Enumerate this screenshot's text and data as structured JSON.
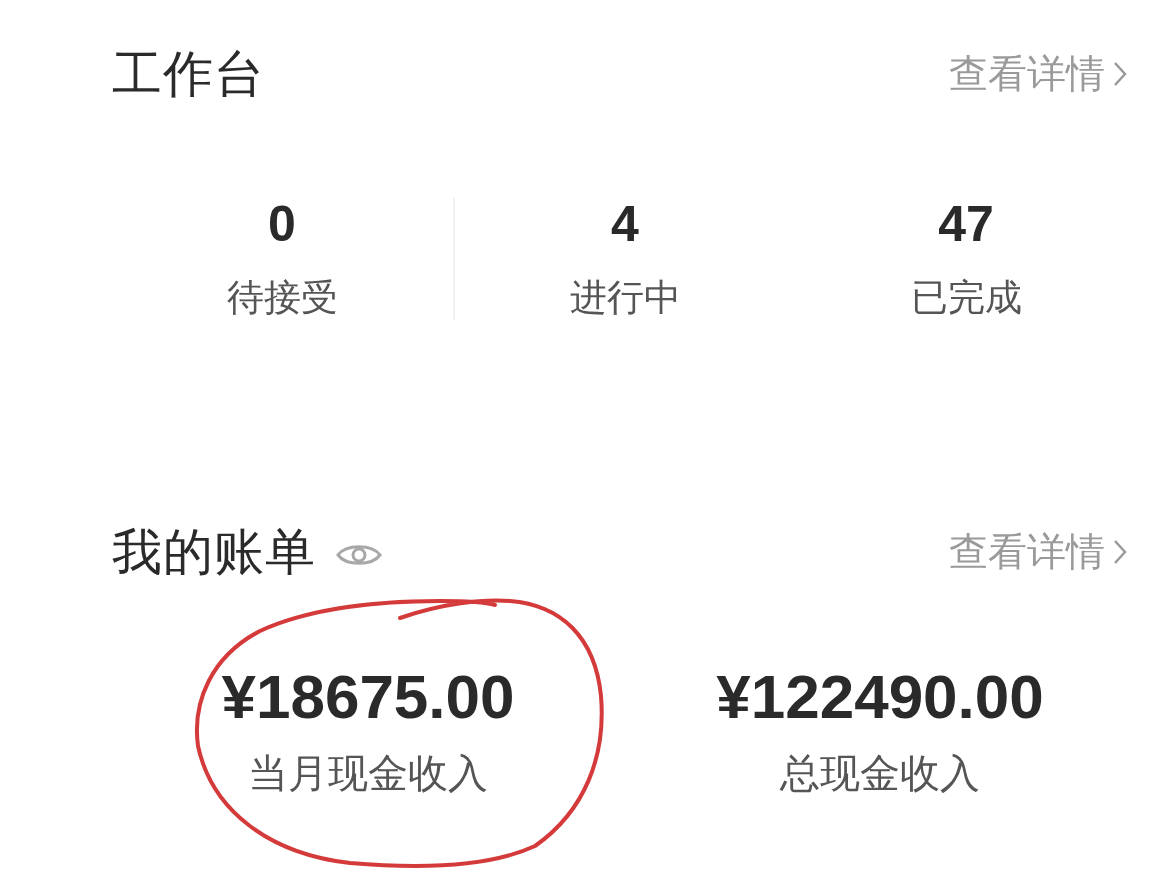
{
  "workbench": {
    "title": "工作台",
    "details_link": "查看详情",
    "stats": [
      {
        "value": "0",
        "label": "待接受"
      },
      {
        "value": "4",
        "label": "进行中"
      },
      {
        "value": "47",
        "label": "已完成"
      }
    ]
  },
  "bill": {
    "title": "我的账单",
    "details_link": "查看详情",
    "amounts": [
      {
        "value": "¥18675.00",
        "label": "当月现金收入",
        "circled": true
      },
      {
        "value": "¥122490.00",
        "label": "总现金收入",
        "circled": false
      }
    ]
  }
}
